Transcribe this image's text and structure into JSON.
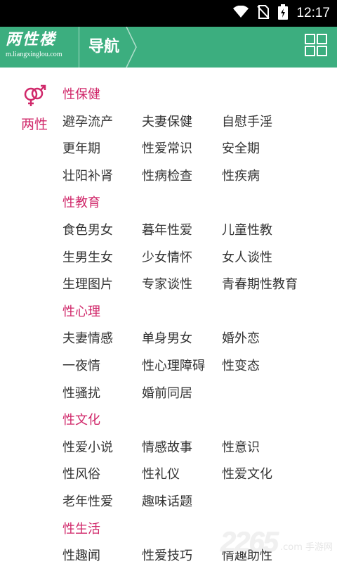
{
  "status": {
    "time": "12:17"
  },
  "header": {
    "logo_text": "两性楼",
    "logo_url": "m.liangxinglou.com",
    "title": "导航"
  },
  "sidebar": {
    "label": "两性"
  },
  "sections": [
    {
      "title": "性保健",
      "items": [
        "避孕流产",
        "夫妻保健",
        "自慰手淫",
        "更年期",
        "性爱常识",
        "安全期",
        "壮阳补肾",
        "性病检查",
        "性疾病"
      ]
    },
    {
      "title": "性教育",
      "items": [
        "食色男女",
        "暮年性爱",
        "儿童性教",
        "生男生女",
        "少女情怀",
        "女人谈性",
        "生理图片",
        "专家谈性",
        "青春期性教育"
      ]
    },
    {
      "title": "性心理",
      "items": [
        "夫妻情感",
        "单身男女",
        "婚外恋",
        "一夜情",
        "性心理障碍",
        "性变态",
        "性骚扰",
        "婚前同居"
      ]
    },
    {
      "title": "性文化",
      "items": [
        "性爱小说",
        "情感故事",
        "性意识",
        "性风俗",
        "性礼仪",
        "性爱文化",
        "老年性爱",
        "趣味话题"
      ]
    },
    {
      "title": "性生活",
      "items": [
        "性趣闻",
        "性爱技巧",
        "情趣助性"
      ]
    }
  ],
  "watermark": {
    "number": "2265",
    "text": ".com 手游网"
  },
  "colors": {
    "accent": "#3cae7f",
    "section": "#d0286a",
    "text": "#333333"
  }
}
